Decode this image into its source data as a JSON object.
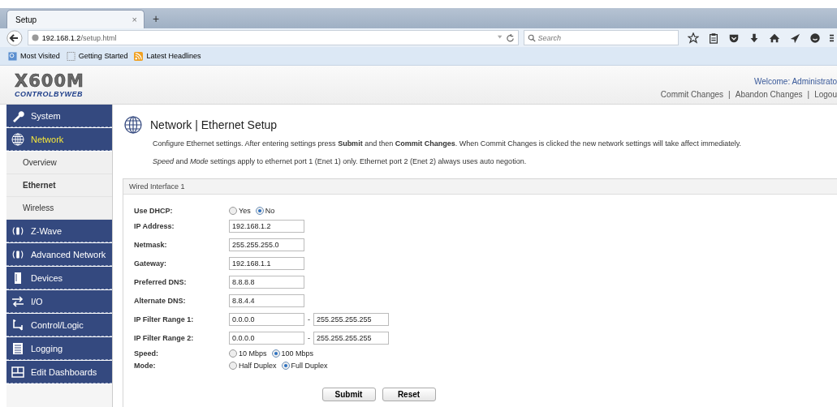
{
  "browser": {
    "tab": {
      "title": "Setup",
      "close": "×"
    },
    "new_tab": "+",
    "url_host": "192.168.1.2",
    "url_path": "/setup.html",
    "search": {
      "placeholder": "Search"
    },
    "bookmarks": [
      "Most Visited",
      "Getting Started",
      "Latest Headlines"
    ]
  },
  "header": {
    "logo_top": "X600M",
    "logo_bottom": "CONTROLBYWEB",
    "welcome": "Welcome: Administrato",
    "links": [
      "Commit Changes",
      "Abandon Changes",
      "Logou"
    ],
    "separator": "|"
  },
  "sidebar": {
    "items": [
      {
        "label": "System",
        "selected": false
      },
      {
        "label": "Network",
        "selected": true,
        "children": [
          {
            "label": "Overview",
            "selected": false
          },
          {
            "label": "Ethernet",
            "selected": true
          },
          {
            "label": "Wireless",
            "selected": false
          }
        ]
      },
      {
        "label": "Z-Wave",
        "selected": false
      },
      {
        "label": "Advanced Network",
        "selected": false
      },
      {
        "label": "Devices",
        "selected": false
      },
      {
        "label": "I/O",
        "selected": false
      },
      {
        "label": "Control/Logic",
        "selected": false
      },
      {
        "label": "Logging",
        "selected": false
      },
      {
        "label": "Edit Dashboards",
        "selected": false
      }
    ]
  },
  "page": {
    "title": "Network | Ethernet Setup",
    "paragraphs": [
      "Configure Ethernet settings. After entering settings press **Submit** and then **Commit Changes**. When Commit Changes is clicked the new network settings will take affect immediately.",
      "*Speed* and *Mode* settings apply to ethernet port 1 (Enet 1) only. Ethernet port 2 (Enet 2) always uses auto negotion."
    ],
    "panel_title": "Wired Interface 1",
    "fields": [
      {
        "kind": "radio",
        "label": "Use DHCP:",
        "options": [
          {
            "label": "Yes",
            "selected": false
          },
          {
            "label": "No",
            "selected": true
          }
        ]
      },
      {
        "kind": "text",
        "label": "IP Address:",
        "value": "192.168.1.2"
      },
      {
        "kind": "text",
        "label": "Netmask:",
        "value": "255.255.255.0"
      },
      {
        "kind": "text",
        "label": "Gateway:",
        "value": "192.168.1.1"
      },
      {
        "kind": "text",
        "label": "Preferred DNS:",
        "value": "8.8.8.8"
      },
      {
        "kind": "text",
        "label": "Alternate DNS:",
        "value": "8.8.4.4"
      },
      {
        "kind": "range",
        "label": "IP Filter Range 1:",
        "value": "0.0.0.0",
        "separator": "-",
        "value_to": "255.255.255.255"
      },
      {
        "kind": "range",
        "label": "IP Filter Range 2:",
        "value": "0.0.0.0",
        "separator": "-",
        "value_to": "255.255.255.255"
      },
      {
        "kind": "radio",
        "label": "Speed:",
        "options": [
          {
            "label": "10 Mbps",
            "selected": false
          },
          {
            "label": "100 Mbps",
            "selected": true
          }
        ]
      },
      {
        "kind": "radio",
        "label": "Mode:",
        "options": [
          {
            "label": "Half Duplex",
            "selected": false
          },
          {
            "label": "Full Duplex",
            "selected": true
          }
        ]
      }
    ],
    "buttons": [
      "Submit",
      "Reset"
    ]
  }
}
